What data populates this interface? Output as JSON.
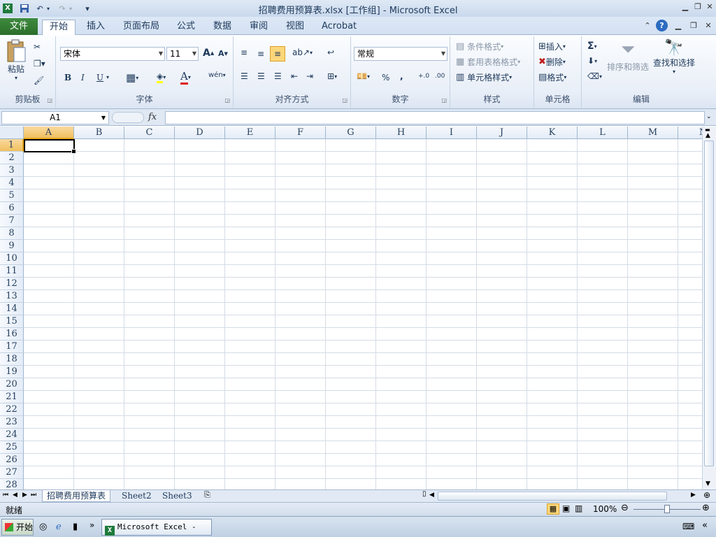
{
  "window": {
    "title": "招聘费用预算表.xlsx  [工作组]  -  Microsoft Excel"
  },
  "quick_access": {
    "menu_glyph": "▾"
  },
  "ribbon_tabs": [
    {
      "label": "文件"
    },
    {
      "label": "开始"
    },
    {
      "label": "插入"
    },
    {
      "label": "页面布局"
    },
    {
      "label": "公式"
    },
    {
      "label": "数据"
    },
    {
      "label": "审阅"
    },
    {
      "label": "视图"
    },
    {
      "label": "Acrobat"
    }
  ],
  "clipboard": {
    "paste": "粘贴",
    "group": "剪贴板"
  },
  "font": {
    "name": "宋体",
    "size": "11",
    "bold": "B",
    "italic": "I",
    "underline": "U",
    "grow": "A",
    "shrink": "A",
    "group": "字体",
    "phonetic": "wén"
  },
  "alignment": {
    "group": "对齐方式"
  },
  "number": {
    "format": "常规",
    "percent": "%",
    "comma": ",",
    "inc_decimal": "+.0",
    "dec_decimal": ".00",
    "group": "数字"
  },
  "styles": {
    "conditional": "条件格式",
    "table": "套用表格格式",
    "cell": "单元格样式",
    "group": "样式"
  },
  "cells": {
    "insert": "插入",
    "delete": "删除",
    "format": "格式",
    "group": "单元格"
  },
  "editing": {
    "sum": "Σ",
    "sort": "排序和筛选",
    "find": "查找和选择",
    "group": "编辑"
  },
  "formula_bar": {
    "name_box": "A1",
    "fx": "fx",
    "value": ""
  },
  "columns": [
    "A",
    "B",
    "C",
    "D",
    "E",
    "F",
    "G",
    "H",
    "I",
    "J",
    "K",
    "L",
    "M",
    "N"
  ],
  "rows": [
    "1",
    "2",
    "3",
    "4",
    "5",
    "6",
    "7",
    "8",
    "9",
    "10",
    "11",
    "12",
    "13",
    "14",
    "15",
    "16",
    "17",
    "18",
    "19",
    "20",
    "21",
    "22",
    "23",
    "24",
    "25",
    "26",
    "27",
    "28"
  ],
  "sheets": [
    "招聘费用预算表",
    "Sheet2",
    "Sheet3"
  ],
  "status": {
    "ready": "就绪",
    "zoom": "100%"
  },
  "taskbar": {
    "start": "开始",
    "app_item": "Microsoft Excel - ...",
    "chevron": "»"
  },
  "colors": {
    "accent": "#2a6e2a",
    "selection_header": "#f1c15f",
    "ribbon_text": "#1e395b"
  }
}
